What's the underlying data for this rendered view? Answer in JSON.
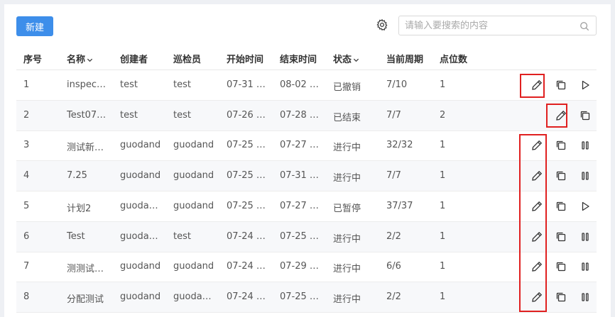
{
  "toolbar": {
    "new_label": "新建",
    "search_placeholder": "请输入要搜索的内容"
  },
  "columns": {
    "index": "序号",
    "name": "名称",
    "creator": "创建者",
    "inspector": "巡检员",
    "start": "开始时间",
    "end": "结束时间",
    "status": "状态",
    "period": "当前周期",
    "points": "点位数"
  },
  "rows": [
    {
      "index": "1",
      "name": "inspect…",
      "creator": "test",
      "inspector": "test",
      "start": "07-31 …",
      "end": "08-02 …",
      "status": "已撤销",
      "period": "7/10",
      "points": "1",
      "third_action": "play"
    },
    {
      "index": "2",
      "name": "Test07…",
      "creator": "test",
      "inspector": "test",
      "start": "07-26 …",
      "end": "07-28 …",
      "status": "已结束",
      "period": "7/7",
      "points": "2",
      "third_action": "none"
    },
    {
      "index": "3",
      "name": "测试新…",
      "creator": "guodand",
      "inspector": "guodand",
      "start": "07-25 …",
      "end": "07-27 …",
      "status": "进行中",
      "period": "32/32",
      "points": "1",
      "third_action": "pause"
    },
    {
      "index": "4",
      "name": "7.25",
      "creator": "guodand",
      "inspector": "guodand",
      "start": "07-25 …",
      "end": "07-31 …",
      "status": "进行中",
      "period": "7/7",
      "points": "1",
      "third_action": "pause"
    },
    {
      "index": "5",
      "name": "计划2",
      "creator": "guoda…",
      "inspector": "guodand",
      "start": "07-25 …",
      "end": "07-27 …",
      "status": "已暂停",
      "period": "37/37",
      "points": "1",
      "third_action": "play"
    },
    {
      "index": "6",
      "name": "Test",
      "creator": "guoda…",
      "inspector": "test",
      "start": "07-24 …",
      "end": "07-25 …",
      "status": "进行中",
      "period": "2/2",
      "points": "1",
      "third_action": "pause"
    },
    {
      "index": "7",
      "name": "测测试…",
      "creator": "guodand",
      "inspector": "guodand",
      "start": "07-24 …",
      "end": "07-29 …",
      "status": "进行中",
      "period": "6/6",
      "points": "1",
      "third_action": "pause"
    },
    {
      "index": "8",
      "name": "分配测试",
      "creator": "guodand",
      "inspector": "guoda…",
      "start": "07-24 …",
      "end": "07-25 …",
      "status": "进行中",
      "period": "2/2",
      "points": "1",
      "third_action": "pause"
    }
  ],
  "icons": {
    "settings": "gear-icon",
    "search": "search-icon",
    "edit": "pencil-icon",
    "copy": "copy-icon",
    "play": "play-icon",
    "pause": "pause-icon",
    "sort": "chevron-down-icon"
  },
  "colors": {
    "primary": "#3d8eea",
    "highlight": "#e02020"
  }
}
